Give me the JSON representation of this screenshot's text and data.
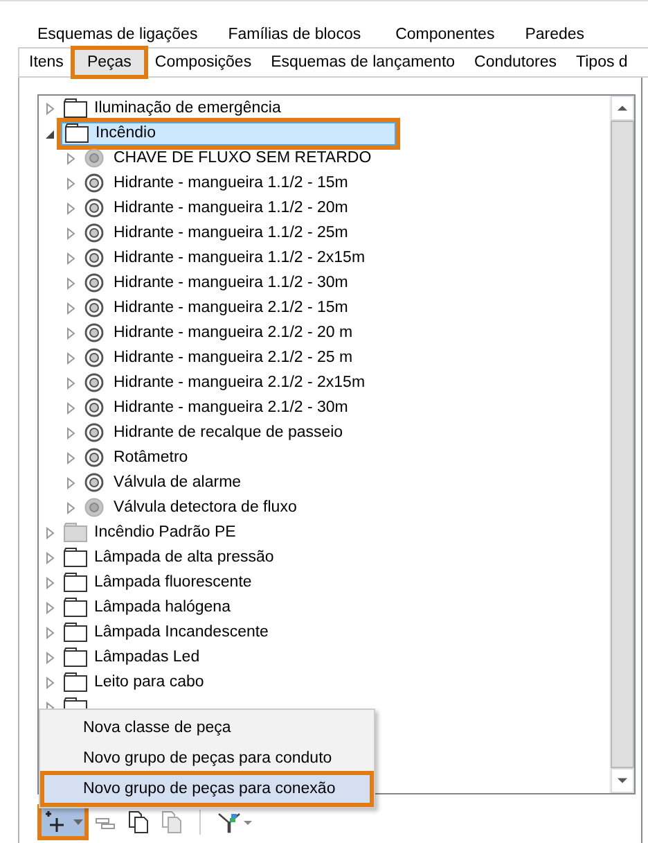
{
  "tabs_back": [
    {
      "label": "Esquemas de ligações"
    },
    {
      "label": "Famílias de blocos"
    },
    {
      "label": "Componentes"
    },
    {
      "label": "Paredes"
    }
  ],
  "tabs": [
    {
      "label": "Itens",
      "selected": false,
      "highlighted": false
    },
    {
      "label": "Peças",
      "selected": true,
      "highlighted": true
    },
    {
      "label": "Composições",
      "selected": false,
      "highlighted": false
    },
    {
      "label": "Esquemas de lançamento",
      "selected": false,
      "highlighted": false
    },
    {
      "label": "Condutores",
      "selected": false,
      "highlighted": false
    },
    {
      "label": "Tipos d",
      "selected": false,
      "highlighted": false
    }
  ],
  "tree": [
    {
      "label": "Iluminação de emergência",
      "kind": "folder",
      "expanded": false,
      "selected": false,
      "highlighted": false
    },
    {
      "label": "Incêndio",
      "kind": "folder",
      "expanded": true,
      "selected": true,
      "highlighted": true,
      "children": [
        {
          "label": "CHAVE DE FLUXO SEM RETARDO",
          "kind": "disk",
          "expanded": false
        },
        {
          "label": "Hidrante - mangueira 1.1/2 - 15m",
          "kind": "target",
          "expanded": false
        },
        {
          "label": "Hidrante - mangueira 1.1/2 - 20m",
          "kind": "target",
          "expanded": false
        },
        {
          "label": "Hidrante - mangueira 1.1/2 - 25m",
          "kind": "target",
          "expanded": false
        },
        {
          "label": "Hidrante - mangueira 1.1/2 - 2x15m",
          "kind": "target",
          "expanded": false
        },
        {
          "label": "Hidrante - mangueira 1.1/2 - 30m",
          "kind": "target",
          "expanded": false
        },
        {
          "label": "Hidrante - mangueira 2.1/2 - 15m",
          "kind": "target",
          "expanded": false
        },
        {
          "label": "Hidrante - mangueira 2.1/2 - 20 m",
          "kind": "target",
          "expanded": false
        },
        {
          "label": "Hidrante - mangueira 2.1/2 - 25 m",
          "kind": "target",
          "expanded": false
        },
        {
          "label": "Hidrante - mangueira 2.1/2 - 2x15m",
          "kind": "target",
          "expanded": false
        },
        {
          "label": "Hidrante - mangueira 2.1/2 - 30m",
          "kind": "target",
          "expanded": false
        },
        {
          "label": "Hidrante de recalque de passeio",
          "kind": "target",
          "expanded": false
        },
        {
          "label": "Rotâmetro",
          "kind": "target",
          "expanded": false
        },
        {
          "label": "Válvula de alarme",
          "kind": "target",
          "expanded": false
        },
        {
          "label": "Válvula detectora de fluxo",
          "kind": "disk",
          "expanded": false
        }
      ]
    },
    {
      "label": "Incêndio Padrão PE",
      "kind": "folder_gray",
      "expanded": false,
      "selected": false,
      "highlighted": false
    },
    {
      "label": "Lâmpada de alta pressão",
      "kind": "folder",
      "expanded": false,
      "selected": false,
      "highlighted": false
    },
    {
      "label": "Lâmpada fluorescente",
      "kind": "folder",
      "expanded": false,
      "selected": false,
      "highlighted": false
    },
    {
      "label": "Lâmpada halógena",
      "kind": "folder",
      "expanded": false,
      "selected": false,
      "highlighted": false
    },
    {
      "label": "Lâmpada Incandescente",
      "kind": "folder",
      "expanded": false,
      "selected": false,
      "highlighted": false
    },
    {
      "label": "Lâmpadas Led",
      "kind": "folder",
      "expanded": false,
      "selected": false,
      "highlighted": false
    },
    {
      "label": "Leito para cabo",
      "kind": "folder",
      "expanded": false,
      "selected": false,
      "highlighted": false
    },
    {
      "kind": "folder",
      "expanded": false,
      "selected": false,
      "highlighted": false
    }
  ],
  "menu": [
    {
      "label": "Nova classe de peça",
      "selected": false,
      "highlighted": false
    },
    {
      "label": "Novo grupo de peças para conduto",
      "selected": false,
      "highlighted": false
    },
    {
      "label": "Novo grupo de peças para conexão",
      "selected": true,
      "highlighted": true
    }
  ],
  "toolbar": [
    {
      "kind": "add",
      "disabled": false,
      "pressed": true,
      "highlighted": true
    },
    {
      "kind": "remove",
      "disabled": false,
      "pressed": false,
      "highlighted": false
    },
    {
      "kind": "copy",
      "disabled": false,
      "pressed": false,
      "highlighted": false
    },
    {
      "kind": "paste",
      "disabled": true,
      "pressed": false,
      "highlighted": false
    },
    {
      "kind": "separator"
    },
    {
      "kind": "filter",
      "disabled": false,
      "pressed": false,
      "highlighted": false
    }
  ]
}
